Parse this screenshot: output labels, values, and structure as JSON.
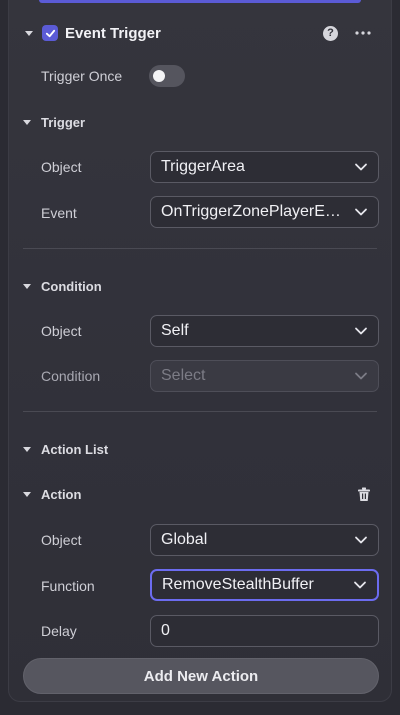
{
  "component": {
    "title": "Event Trigger",
    "enabled": true,
    "trigger_once_label": "Trigger Once",
    "trigger_once_on": false
  },
  "trigger": {
    "title": "Trigger",
    "object_label": "Object",
    "object_value": "TriggerArea",
    "event_label": "Event",
    "event_value": "OnTriggerZonePlayerEnter"
  },
  "condition": {
    "title": "Condition",
    "object_label": "Object",
    "object_value": "Self",
    "condition_label": "Condition",
    "condition_placeholder": "Select"
  },
  "action_list": {
    "title": "Action List",
    "action_title": "Action",
    "object_label": "Object",
    "object_value": "Global",
    "function_label": "Function",
    "function_value": "RemoveStealthBuffer",
    "delay_label": "Delay",
    "delay_value": "0",
    "add_button_label": "Add New Action"
  },
  "colors": {
    "accent": "#5b5bd6",
    "background": "#2b2b33"
  },
  "icons": [
    "help-icon",
    "more-icon",
    "trash-icon",
    "chevron-down-icon",
    "caret-down-icon",
    "check-icon"
  ]
}
